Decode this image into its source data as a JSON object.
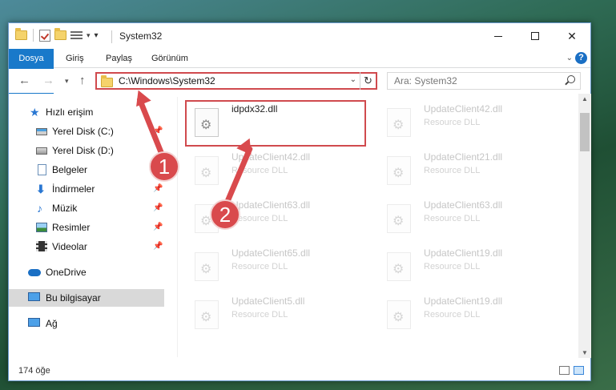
{
  "window": {
    "title": "System32",
    "help_label": "?"
  },
  "ribbon": {
    "tabs": [
      "Dosya",
      "Giriş",
      "Paylaş",
      "Görünüm"
    ]
  },
  "nav": {
    "address": "C:\\Windows\\System32",
    "search_placeholder": "Ara: System32"
  },
  "sidebar": {
    "items": [
      {
        "label": "Hızlı erişim",
        "icon": "star-icon"
      },
      {
        "label": "Yerel Disk (C:)",
        "icon": "drive-c-icon",
        "pinned": true
      },
      {
        "label": "Yerel Disk (D:)",
        "icon": "drive-d-icon"
      },
      {
        "label": "Belgeler",
        "icon": "documents-icon"
      },
      {
        "label": "İndirmeler",
        "icon": "downloads-icon",
        "pinned": true
      },
      {
        "label": "Müzik",
        "icon": "music-icon",
        "pinned": true
      },
      {
        "label": "Resimler",
        "icon": "pictures-icon",
        "pinned": true
      },
      {
        "label": "Videolar",
        "icon": "videos-icon",
        "pinned": true
      },
      {
        "label": "OneDrive",
        "icon": "onedrive-icon"
      },
      {
        "label": "Bu bilgisayar",
        "icon": "this-pc-icon",
        "selected": true
      },
      {
        "label": "Ağ",
        "icon": "network-icon"
      }
    ]
  },
  "files": [
    {
      "name": "idpdx32.dll",
      "type": "",
      "highlighted": true
    },
    {
      "name": "UpdateClient42.dll",
      "type": "Resource DLL"
    },
    {
      "name": "UpdateClient42.dll",
      "type": "Resource DLL"
    },
    {
      "name": "UpdateClient21.dll",
      "type": "Resource DLL"
    },
    {
      "name": "UpdateClient63.dll",
      "type": "Resource DLL"
    },
    {
      "name": "UpdateClient63.dll",
      "type": "Resource DLL"
    },
    {
      "name": "UpdateClient65.dll",
      "type": "Resource DLL"
    },
    {
      "name": "UpdateClient19.dll",
      "type": "Resource DLL"
    },
    {
      "name": "UpdateClient5.dll",
      "type": "Resource DLL"
    },
    {
      "name": "UpdateClient19.dll",
      "type": "Resource DLL"
    }
  ],
  "status": {
    "count": "174 öğe"
  },
  "annotations": {
    "step1": "1",
    "step2": "2"
  },
  "colors": {
    "accent": "#1979ca",
    "annotation": "#d94a4d"
  }
}
